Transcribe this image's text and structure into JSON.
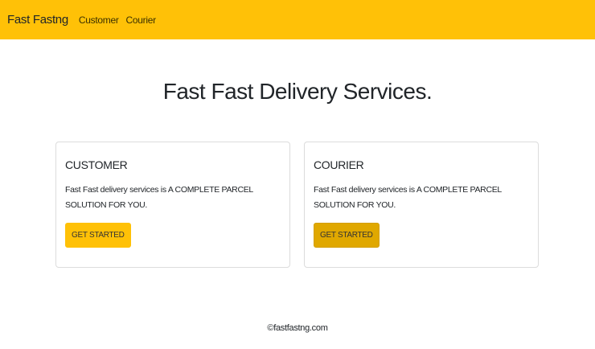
{
  "nav": {
    "brand": "Fast Fastng",
    "links": [
      "Customer",
      "Courier"
    ]
  },
  "heading": "Fast Fast Delivery Services.",
  "cards": [
    {
      "title": "CUSTOMER",
      "text": "Fast Fast delivery services is A COMPLETE PARCEL SOLUTION FOR YOU.",
      "button": "GET STARTED"
    },
    {
      "title": "COURIER",
      "text": "Fast Fast delivery services is A COMPLETE PARCEL SOLUTION FOR YOU.",
      "button": "GET STARTED"
    }
  ],
  "footer": "©fastfastng.com"
}
